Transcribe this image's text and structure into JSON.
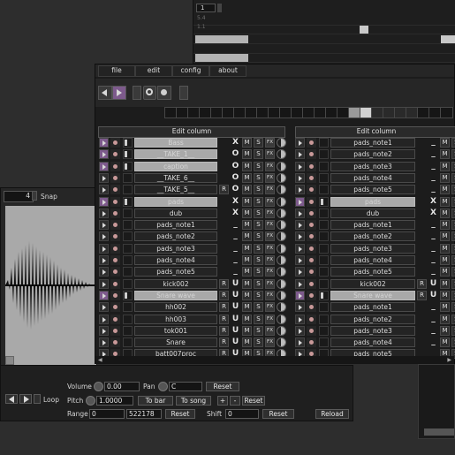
{
  "sequencer": {
    "position": "1",
    "lanes": [
      "5.4",
      "1.1",
      "",
      "",
      ""
    ]
  },
  "mixer": {
    "menu": [
      "file",
      "edit",
      "config",
      "about"
    ],
    "left_column_title": "Edit column",
    "right_column_title": "Edit column",
    "left_rows": [
      {
        "name": "Bass",
        "selected": true,
        "icon": "X",
        "fx": "FX"
      },
      {
        "name": "__TAKE_1__",
        "selected": true,
        "icon": "O",
        "fx": "FX"
      },
      {
        "name": "caption",
        "selected": true,
        "icon": "O",
        "fx": "FX"
      },
      {
        "name": "__TAKE_6__",
        "selected": false,
        "icon": "O",
        "fx": "FX"
      },
      {
        "name": "__TAKE_5__",
        "selected": false,
        "icon": "O",
        "fx": "FX",
        "r": "R"
      },
      {
        "name": "pads",
        "selected": true,
        "icon": "X",
        "fx": "FX"
      },
      {
        "name": "dub",
        "selected": false,
        "icon": "X",
        "fx": "FX"
      },
      {
        "name": "pads_note1",
        "selected": false,
        "icon": "_",
        "fx": "FX"
      },
      {
        "name": "pads_note2",
        "selected": false,
        "icon": "_",
        "fx": "FX"
      },
      {
        "name": "pads_note3",
        "selected": false,
        "icon": "_",
        "fx": "FX"
      },
      {
        "name": "pads_note4",
        "selected": false,
        "icon": "_",
        "fx": "FX"
      },
      {
        "name": "pads_note5",
        "selected": false,
        "icon": "_",
        "fx": "FX"
      },
      {
        "name": "kick002",
        "selected": false,
        "icon": "U",
        "fx": "FX",
        "r": "R"
      },
      {
        "name": "Snare wave",
        "selected": true,
        "icon": "U",
        "fx": "FX",
        "r": "R"
      },
      {
        "name": "hh002",
        "selected": false,
        "icon": "U",
        "fx": "FX",
        "r": "R"
      },
      {
        "name": "hh003",
        "selected": false,
        "icon": "U",
        "fx": "FX",
        "r": "R"
      },
      {
        "name": "tok001",
        "selected": false,
        "icon": "U",
        "fx": "FX",
        "r": "R"
      },
      {
        "name": "Snare",
        "selected": false,
        "icon": "U",
        "fx": "FX",
        "r": "R"
      },
      {
        "name": "batt007proc",
        "selected": false,
        "icon": "U",
        "fx": "FX",
        "r": "R"
      }
    ],
    "right_rows": [
      {
        "name": "pads_note1",
        "selected": false,
        "icon": "_"
      },
      {
        "name": "pads_note2",
        "selected": false,
        "icon": "_"
      },
      {
        "name": "pads_note3",
        "selected": false,
        "icon": "_"
      },
      {
        "name": "pads_note4",
        "selected": false,
        "icon": "_"
      },
      {
        "name": "pads_note5",
        "selected": false,
        "icon": "_"
      },
      {
        "name": "pads",
        "selected": true,
        "icon": "X"
      },
      {
        "name": "dub",
        "selected": false,
        "icon": "X"
      },
      {
        "name": "pads_note1",
        "selected": false,
        "icon": "_"
      },
      {
        "name": "pads_note2",
        "selected": false,
        "icon": "_"
      },
      {
        "name": "pads_note3",
        "selected": false,
        "icon": "_"
      },
      {
        "name": "pads_note4",
        "selected": false,
        "icon": "_"
      },
      {
        "name": "pads_note5",
        "selected": false,
        "icon": "_"
      },
      {
        "name": "kick002",
        "selected": false,
        "icon": "U",
        "r": "R"
      },
      {
        "name": "Snare wave",
        "selected": true,
        "icon": "U",
        "r": "R"
      },
      {
        "name": "pads_note1",
        "selected": false,
        "icon": "_"
      },
      {
        "name": "pads_note2",
        "selected": false,
        "icon": "_"
      },
      {
        "name": "pads_note3",
        "selected": false,
        "icon": "_"
      },
      {
        "name": "pads_note4",
        "selected": false,
        "icon": "_"
      },
      {
        "name": "pads_note5",
        "selected": false,
        "icon": "_"
      }
    ],
    "m_label": "M",
    "s_label": "S"
  },
  "sampler": {
    "snap_value": "4",
    "snap_label": "Snap"
  },
  "panel": {
    "loop_label": "Loop",
    "volume_label": "Volume",
    "volume_value": "0.00",
    "pan_label": "Pan",
    "pan_value": "C",
    "reset_label": "Reset",
    "pitch_label": "Pitch",
    "pitch_value": "1.0000",
    "to_bar_label": "To bar",
    "to_song_label": "To song",
    "plus_label": "+",
    "minus_label": "-",
    "range_label": "Range",
    "range_start": "0",
    "range_end": "522178",
    "shift_label": "Shift",
    "shift_value": "0",
    "reload_label": "Reload"
  },
  "colors": {
    "accent": "#7d5a8c",
    "selected_row": "#a9a9a9",
    "record_dot": "#c99999"
  }
}
